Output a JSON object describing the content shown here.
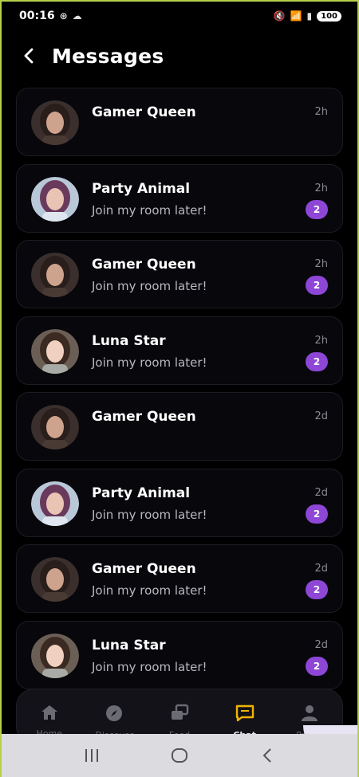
{
  "status_bar": {
    "time": "00:16",
    "battery": "100"
  },
  "header": {
    "title": "Messages"
  },
  "conversations": [
    {
      "name": "Gamer Queen",
      "message": "",
      "time": "2h",
      "unread": "",
      "avatar": "gamer"
    },
    {
      "name": "Party Animal",
      "message": "Join my room later!",
      "time": "2h",
      "unread": "2",
      "avatar": "party"
    },
    {
      "name": "Gamer Queen",
      "message": "Join my room later!",
      "time": "2h",
      "unread": "2",
      "avatar": "gamer"
    },
    {
      "name": "Luna Star",
      "message": "Join my room later!",
      "time": "2h",
      "unread": "2",
      "avatar": "luna"
    },
    {
      "name": "Gamer Queen",
      "message": "",
      "time": "2d",
      "unread": "",
      "avatar": "gamer"
    },
    {
      "name": "Party Animal",
      "message": "Join my room later!",
      "time": "2d",
      "unread": "2",
      "avatar": "party"
    },
    {
      "name": "Gamer Queen",
      "message": "Join my room later!",
      "time": "2d",
      "unread": "2",
      "avatar": "gamer"
    },
    {
      "name": "Luna Star",
      "message": "Join my room later!",
      "time": "2d",
      "unread": "2",
      "avatar": "luna"
    }
  ],
  "bottom_nav": {
    "items": [
      {
        "label": "Home",
        "icon": "home-icon"
      },
      {
        "label": "Discover",
        "icon": "compass-icon"
      },
      {
        "label": "Feed",
        "icon": "stack-icon"
      },
      {
        "label": "Chat",
        "icon": "chat-icon"
      },
      {
        "label": "Profile",
        "icon": "person-icon"
      }
    ],
    "active": "Chat"
  },
  "colors": {
    "accent": "#8d46d6",
    "active_nav": "#f0b400",
    "background": "#000000"
  }
}
